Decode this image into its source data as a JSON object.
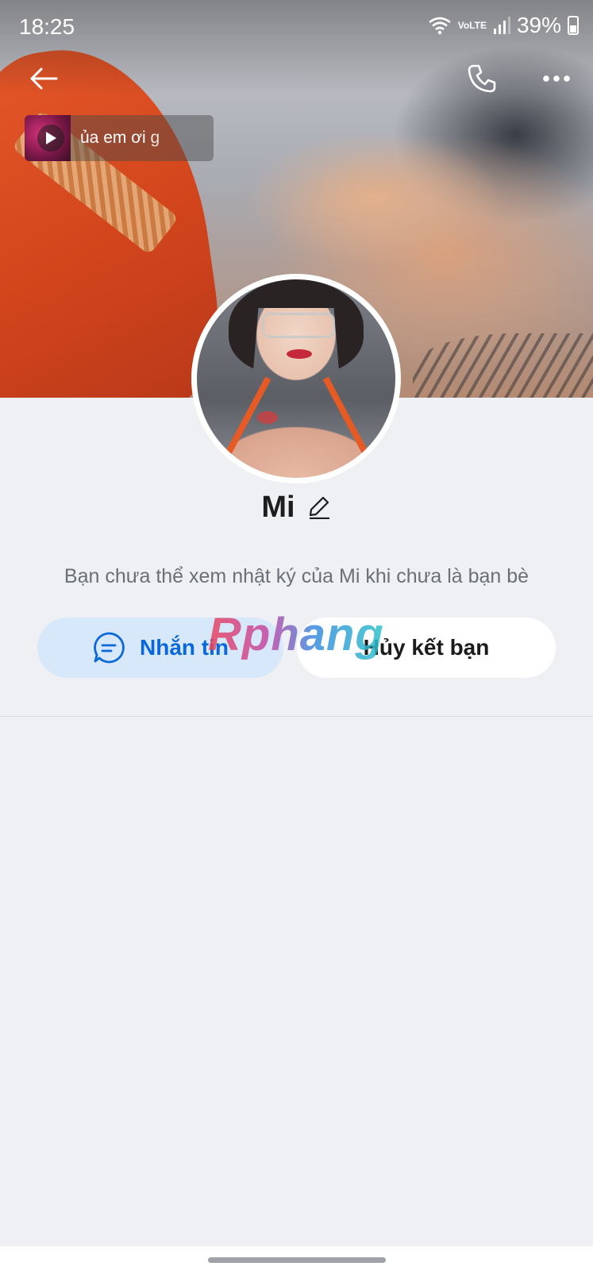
{
  "status_bar": {
    "time": "18:25",
    "battery": "39%",
    "network": "VoLTE",
    "icons": [
      "wifi-icon",
      "volte-icon",
      "signal-icon",
      "battery-icon"
    ]
  },
  "nav": {
    "icons": [
      "back-arrow-icon",
      "phone-icon",
      "more-icon"
    ]
  },
  "music": {
    "text": "ủa em ơi      g"
  },
  "profile": {
    "name": "Mi",
    "info": "Bạn chưa thể xem nhật ký của Mi khi chưa là bạn bè"
  },
  "actions": {
    "message_label": "Nhắn tin",
    "unfriend_label": "Hủy kết bạn"
  },
  "watermark": {
    "text": "Rphang"
  },
  "colors": {
    "background": "#eef0f3",
    "accent": "#0a68d8",
    "message_button_bg": "#d8e8fb",
    "unfriend_button_bg": "#ffffff"
  }
}
